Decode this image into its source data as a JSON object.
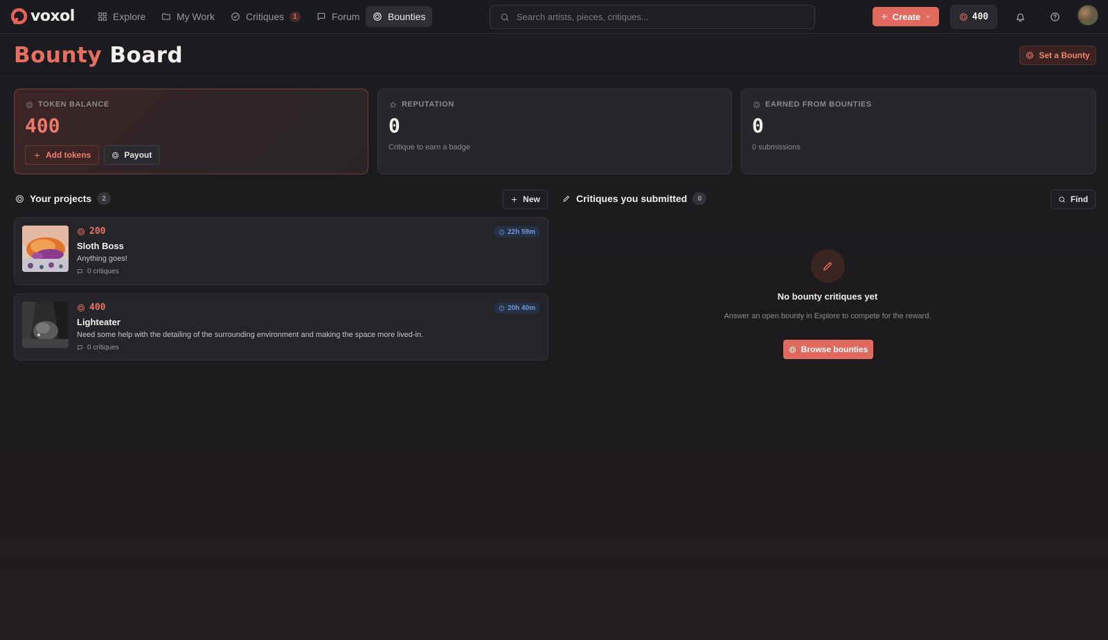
{
  "app": {
    "logo_text": "voxol"
  },
  "nav": {
    "items": [
      {
        "label": "Explore",
        "icon": "grid-icon"
      },
      {
        "label": "My Work",
        "icon": "folder-icon"
      },
      {
        "label": "Critiques",
        "icon": "check-circle-icon",
        "badge": "1"
      },
      {
        "label": "Forum",
        "icon": "message-square-icon"
      },
      {
        "label": "Bounties",
        "icon": "target-icon",
        "active": true
      }
    ],
    "search_placeholder": "Search artists, pieces, critiques...",
    "create_label": "Create",
    "token_count": "400"
  },
  "page": {
    "title_part1": "Bounty",
    "title_part2": "Board",
    "set_bounty_label": "Set a Bounty"
  },
  "stats": {
    "token_balance": {
      "label": "TOKEN BALANCE",
      "value": "400",
      "add_label": "Add tokens",
      "payout_label": "Payout"
    },
    "reputation": {
      "label": "REPUTATION",
      "value": "0",
      "sub": "Critique to earn a badge"
    },
    "earned": {
      "label": "EARNED FROM BOUNTIES",
      "value": "0",
      "sub": "0 submissions"
    }
  },
  "projects": {
    "title": "Your projects",
    "count": "2",
    "new_label": "New",
    "items": [
      {
        "bounty": "200",
        "title": "Sloth Boss",
        "description": "Anything goes!",
        "critiques": "0 critiques",
        "time_left": "22h 59m"
      },
      {
        "bounty": "400",
        "title": "Lighteater",
        "description": "Need some help with the detailing of the surrounding environment and making the space more lived-in.",
        "critiques": "0 critiques",
        "time_left": "20h 40m"
      }
    ]
  },
  "submitted": {
    "title": "Critiques you submitted",
    "count": "0",
    "find_label": "Find",
    "empty_title": "No bounty critiques yet",
    "empty_desc": "Answer an open bounty in Explore to compete for the reward.",
    "browse_label": "Browse bounties"
  },
  "colors": {
    "accent": "#e06a5d",
    "background": "#1c1c20",
    "card": "#27262b",
    "timer_text": "#6f9ad4"
  }
}
